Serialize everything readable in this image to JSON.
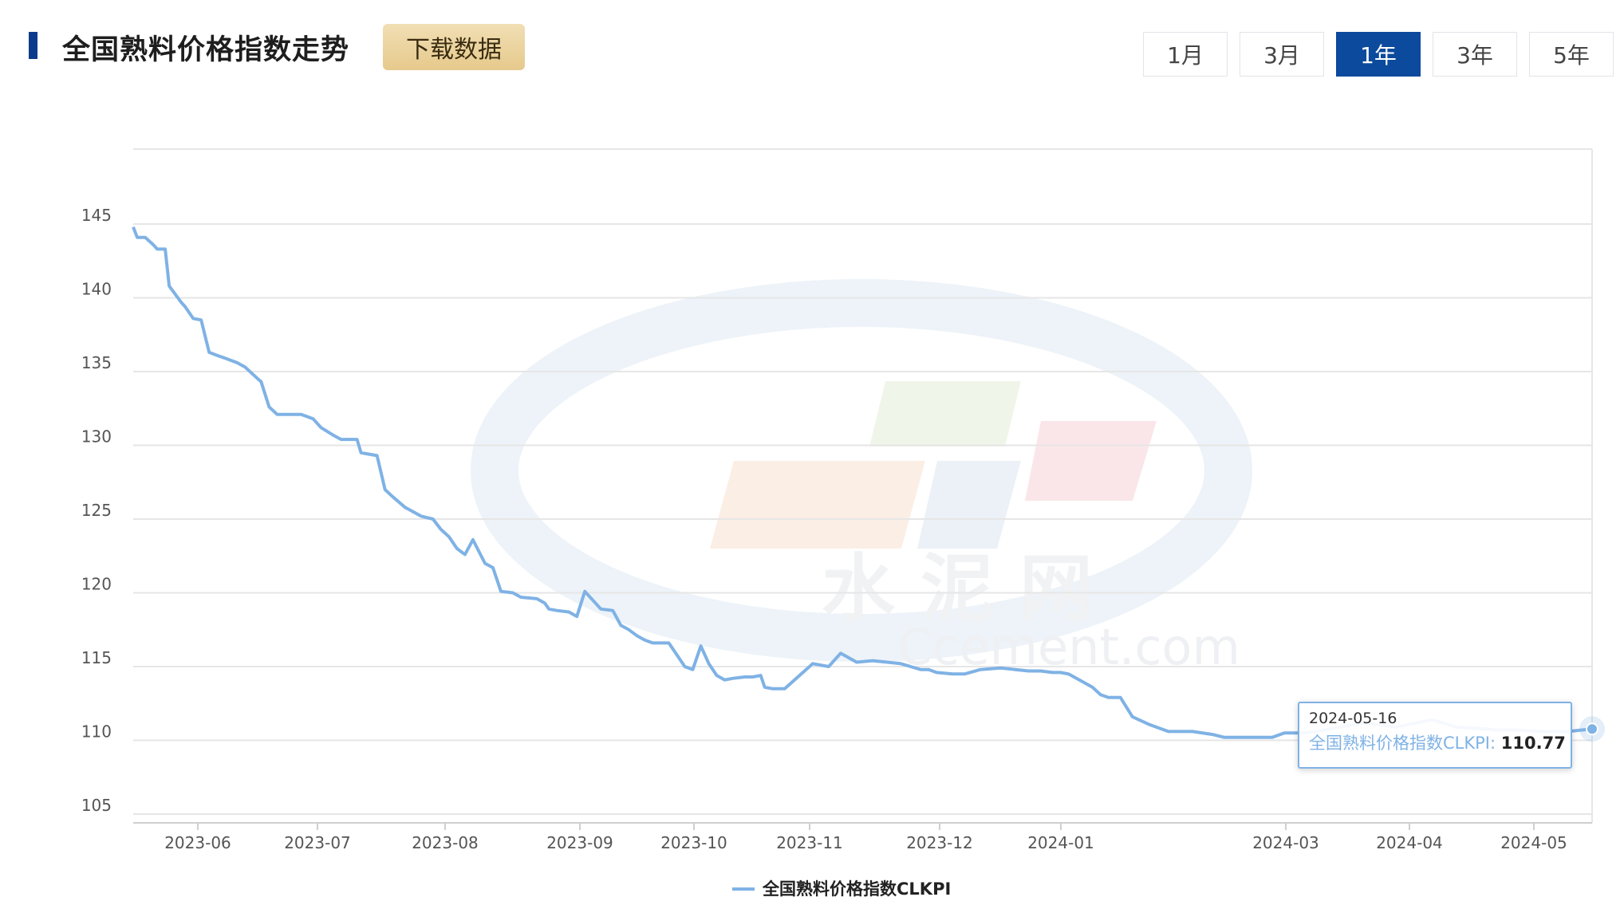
{
  "header": {
    "title": "全国熟料价格指数走势",
    "download_label": "下载数据",
    "ranges": [
      "1月",
      "3月",
      "1年",
      "3年",
      "5年"
    ],
    "active_range": "1年"
  },
  "watermark": {
    "cn": "水 泥 网",
    "en": "Ccement.com"
  },
  "colors": {
    "series": "#7fb2e5",
    "accent": "#0b4a9c",
    "grid": "#e6e6e6"
  },
  "tooltip": {
    "date": "2024-05-16",
    "series_name": "全国熟料价格指数CLKPI",
    "value": "110.77"
  },
  "chart_data": {
    "type": "line",
    "title": "",
    "ylim": [
      105,
      145
    ],
    "yticks": [
      105,
      110,
      115,
      120,
      125,
      130,
      135,
      140,
      145
    ],
    "xticks": [
      "2023-06",
      "2023-07",
      "2023-08",
      "2023-09",
      "2023-10",
      "2023-11",
      "2023-12",
      "2024-01",
      "2024-03",
      "2024-04",
      "2024-05"
    ],
    "grid": true,
    "legend": "bottom-center",
    "series": [
      {
        "name": "全国熟料价格指数CLKPI",
        "x": [
          "2023-05-17",
          "2023-05-18",
          "2023-05-20",
          "2023-05-22",
          "2023-05-23",
          "2023-05-25",
          "2023-05-26",
          "2023-05-29",
          "2023-05-30",
          "2023-06-01",
          "2023-06-03",
          "2023-06-05",
          "2023-06-07",
          "2023-06-09",
          "2023-06-12",
          "2023-06-14",
          "2023-06-16",
          "2023-06-18",
          "2023-06-20",
          "2023-06-22",
          "2023-06-25",
          "2023-06-28",
          "2023-07-01",
          "2023-07-03",
          "2023-07-06",
          "2023-07-08",
          "2023-07-10",
          "2023-07-12",
          "2023-07-13",
          "2023-07-15",
          "2023-07-17",
          "2023-07-19",
          "2023-07-21",
          "2023-07-24",
          "2023-07-26",
          "2023-07-28",
          "2023-07-31",
          "2023-08-02",
          "2023-08-04",
          "2023-08-06",
          "2023-08-08",
          "2023-08-10",
          "2023-08-13",
          "2023-08-15",
          "2023-08-17",
          "2023-08-20",
          "2023-08-22",
          "2023-08-26",
          "2023-08-28",
          "2023-08-29",
          "2023-08-31",
          "2023-09-03",
          "2023-09-05",
          "2023-09-07",
          "2023-09-11",
          "2023-09-14",
          "2023-09-16",
          "2023-09-18",
          "2023-09-20",
          "2023-09-22",
          "2023-09-24",
          "2023-09-26",
          "2023-09-28",
          "2023-10-02",
          "2023-10-04",
          "2023-10-06",
          "2023-10-08",
          "2023-10-10",
          "2023-10-12",
          "2023-10-14",
          "2023-10-17",
          "2023-10-19",
          "2023-10-21",
          "2023-10-22",
          "2023-10-24",
          "2023-10-27",
          "2023-11-03",
          "2023-11-07",
          "2023-11-10",
          "2023-11-14",
          "2023-11-18",
          "2023-11-25",
          "2023-11-30",
          "2023-12-02",
          "2023-12-04",
          "2023-12-08",
          "2023-12-11",
          "2023-12-15",
          "2023-12-20",
          "2023-12-27",
          "2023-12-30",
          "2024-01-02",
          "2024-01-04",
          "2024-01-06",
          "2024-01-08",
          "2024-01-12",
          "2024-01-14",
          "2024-01-16",
          "2024-01-19",
          "2024-01-22",
          "2024-01-26",
          "2024-01-29",
          "2024-01-31",
          "2024-02-06",
          "2024-02-11",
          "2024-02-14",
          "2024-02-26",
          "2024-02-29",
          "2024-03-03",
          "2024-03-05",
          "2024-03-08",
          "2024-03-12",
          "2024-03-20",
          "2024-03-28",
          "2024-04-06",
          "2024-04-12",
          "2024-04-18",
          "2024-04-22",
          "2024-04-27",
          "2024-05-04",
          "2024-05-10",
          "2024-05-16"
        ],
        "y": [
          144.8,
          144.1,
          144.1,
          143.6,
          143.3,
          143.3,
          140.8,
          139.7,
          139.4,
          138.6,
          138.5,
          136.3,
          136.1,
          135.9,
          135.6,
          135.3,
          134.8,
          134.3,
          132.6,
          132.1,
          132.1,
          132.1,
          131.8,
          131.2,
          130.7,
          130.4,
          130.4,
          130.4,
          129.5,
          129.4,
          129.3,
          127.0,
          126.5,
          125.8,
          125.5,
          125.2,
          125.0,
          124.3,
          123.8,
          123.0,
          122.6,
          123.6,
          122.0,
          121.7,
          120.1,
          120.0,
          119.7,
          119.6,
          119.3,
          118.9,
          118.8,
          118.7,
          118.4,
          120.1,
          118.9,
          118.8,
          117.8,
          117.5,
          117.1,
          116.8,
          116.6,
          116.6,
          116.6,
          115.0,
          114.8,
          116.4,
          115.2,
          114.4,
          114.1,
          114.2,
          114.3,
          114.3,
          114.4,
          113.6,
          113.5,
          113.5,
          115.2,
          115.0,
          115.9,
          115.3,
          115.4,
          115.2,
          114.8,
          114.8,
          114.6,
          114.5,
          114.5,
          114.8,
          114.9,
          114.7,
          114.7,
          114.6,
          114.6,
          114.5,
          114.2,
          113.6,
          113.1,
          112.9,
          112.9,
          111.6,
          111.1,
          110.8,
          110.6,
          110.6,
          110.4,
          110.2,
          110.2,
          110.5,
          110.5,
          110.5,
          110.6,
          110.8,
          111.2,
          110.9,
          111.4,
          110.9,
          110.8,
          110.7,
          110.7,
          110.6,
          110.6,
          110.77
        ]
      }
    ]
  }
}
